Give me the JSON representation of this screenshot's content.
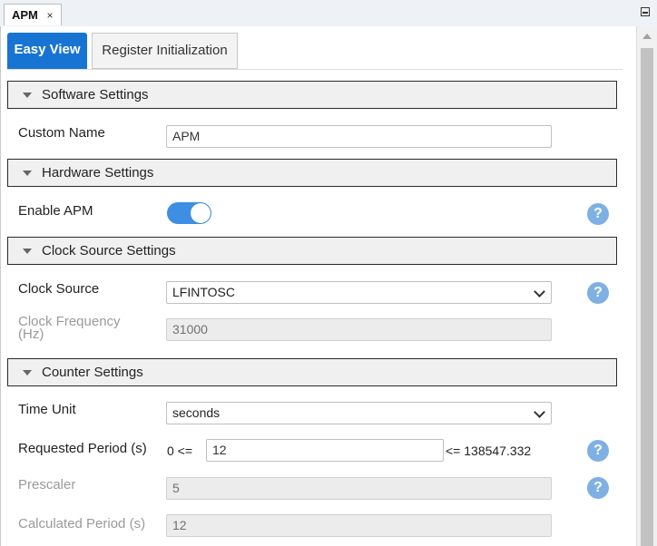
{
  "document_tab": {
    "title": "APM",
    "close": "×"
  },
  "view_tabs": {
    "active": "Easy View",
    "inactive": "Register Initialization"
  },
  "sections": {
    "software": "Software Settings",
    "hardware": "Hardware Settings",
    "clock": "Clock Source Settings",
    "counter": "Counter Settings"
  },
  "fields": {
    "custom_name": {
      "label": "Custom Name",
      "value": "APM"
    },
    "enable_apm": {
      "label": "Enable APM",
      "state": "on"
    },
    "clock_source": {
      "label": "Clock Source",
      "value": "LFINTOSC"
    },
    "clock_frequency": {
      "label_line1": "Clock Frequency",
      "label_line2": "(Hz)",
      "value": "31000"
    },
    "time_unit": {
      "label": "Time Unit",
      "value": "seconds"
    },
    "requested_period": {
      "label": "Requested Period (s)",
      "prefix": "0 <=",
      "value": "12",
      "suffix": "<= 138547.332"
    },
    "prescaler": {
      "label": "Prescaler",
      "value": "5"
    },
    "calculated_period": {
      "label": "Calculated Period (s)",
      "value": "12"
    }
  },
  "help_icon_text": "?",
  "colors": {
    "accent": "#1874d2",
    "toggle_on": "#3c8fe3",
    "help_icon": "#7fb0e3"
  }
}
